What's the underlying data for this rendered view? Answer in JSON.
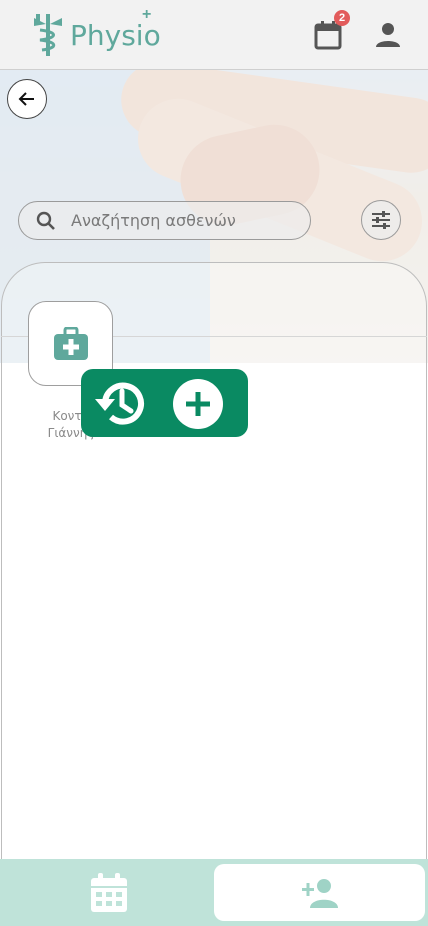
{
  "header": {
    "brand": "Physio",
    "brand_plus": "+",
    "calendar_badge": "2",
    "icons": {
      "logo": "caduceus-icon",
      "calendar": "calendar-icon",
      "profile": "person-icon"
    }
  },
  "search": {
    "placeholder": "Αναζήτηση ασθενών",
    "value": ""
  },
  "patients": [
    {
      "name_line1": "Κοντα",
      "name_line2": "Γιάννης",
      "icon": "medical-kit-icon"
    }
  ],
  "popup": {
    "icons": [
      "history-icon",
      "add-icon"
    ]
  },
  "bottom_nav": {
    "icons": [
      "calendar-icon",
      "add-person-icon"
    ],
    "active": "add-person-icon"
  },
  "colors": {
    "brand_teal": "#5fa89c",
    "popup_green": "#0a8a62",
    "nav_bg": "#bfe3d9",
    "badge_red": "#e25b5b"
  }
}
